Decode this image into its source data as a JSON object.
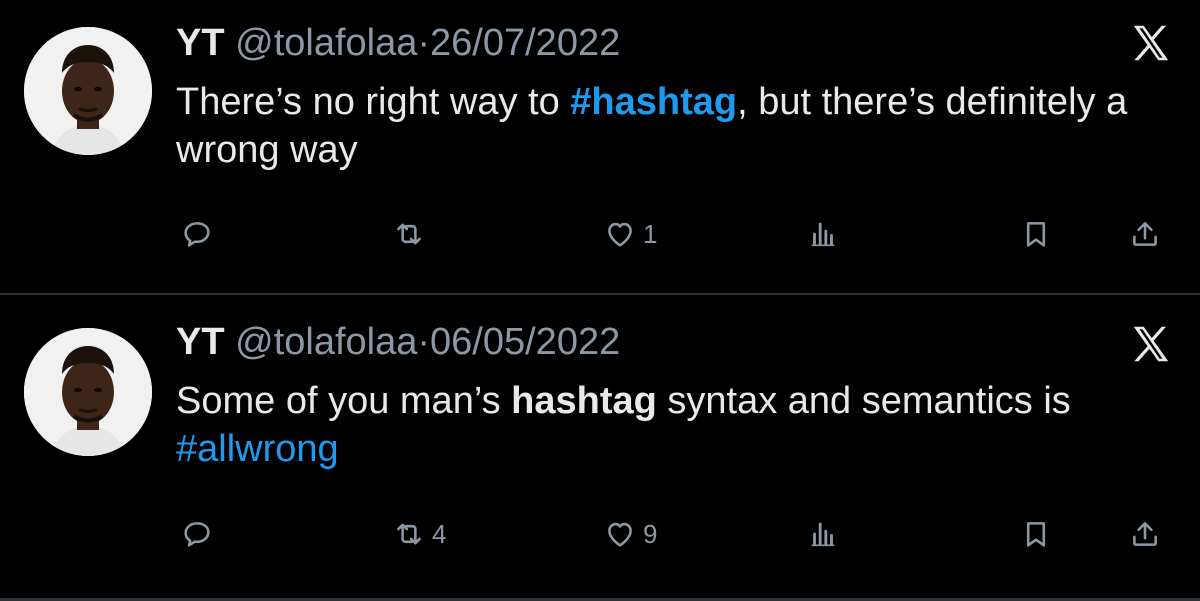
{
  "colors": {
    "background": "#000000",
    "text": "#e7e9ea",
    "muted": "#8b98a5",
    "hashtag": "#1d9bf0",
    "divider": "#2f3336"
  },
  "tweets": [
    {
      "name": "YT",
      "handle": "@tolafolaa",
      "separator": "·",
      "date": "26/07/2022",
      "text_parts": {
        "p1": "There’s no right way to ",
        "p2": "#hashtag",
        "p3": ", but there’s definitely a wrong way"
      },
      "actions": {
        "reply_count": "",
        "retweet_count": "",
        "like_count": "1",
        "views_count": ""
      },
      "icons": [
        "reply-icon",
        "retweet-icon",
        "like-icon",
        "views-icon",
        "bookmark-icon",
        "share-icon",
        "x-logo-icon"
      ]
    },
    {
      "name": "YT",
      "handle": "@tolafolaa",
      "separator": "·",
      "date": "06/05/2022",
      "text_parts": {
        "p1": "Some of you man’s ",
        "p2": "hashtag",
        "p3": " syntax and semantics is ",
        "p4": "#allwrong"
      },
      "actions": {
        "reply_count": "",
        "retweet_count": "4",
        "like_count": "9",
        "views_count": ""
      },
      "icons": [
        "reply-icon",
        "retweet-icon",
        "like-icon",
        "views-icon",
        "bookmark-icon",
        "share-icon",
        "x-logo-icon"
      ]
    }
  ]
}
